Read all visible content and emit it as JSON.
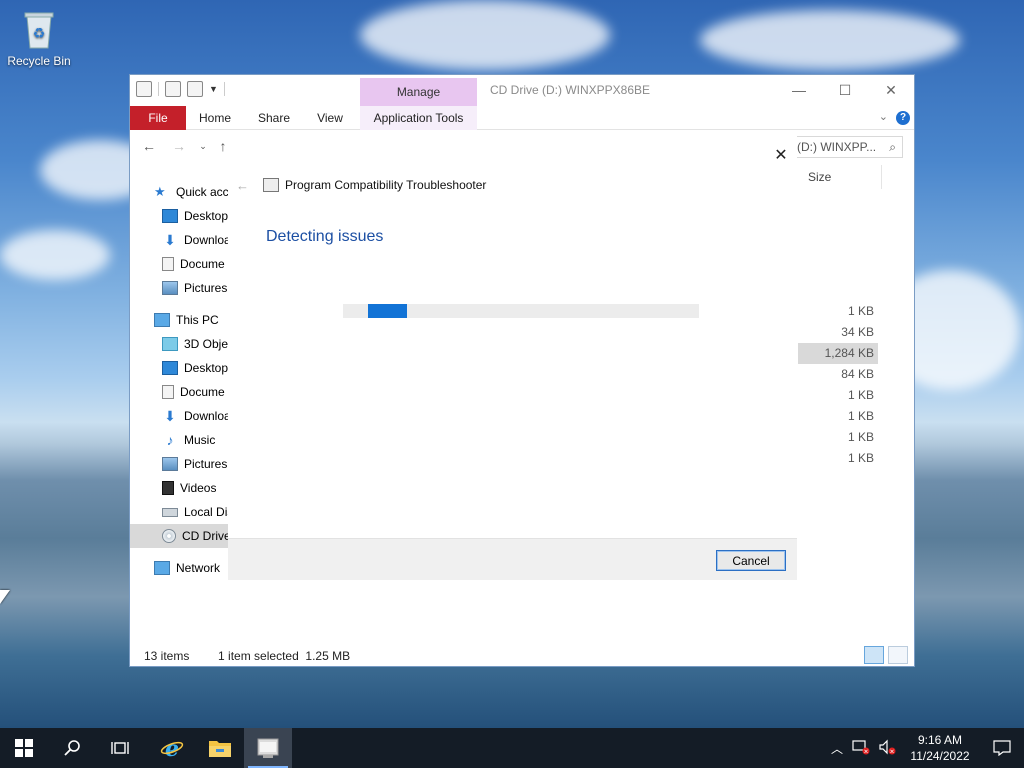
{
  "desktop": {
    "recycle_bin_label": "Recycle Bin"
  },
  "explorer": {
    "title": "CD Drive (D:) WINXPPX86BE",
    "manage_tab": "Manage",
    "ribbon_tabs": {
      "file": "File",
      "home": "Home",
      "share": "Share",
      "view": "View",
      "application_tools": "Application Tools"
    },
    "search_text": "(D:) WINXPP...",
    "column_size": "Size",
    "nav": {
      "quick_access": "Quick acc",
      "qa_desktop": "Desktop",
      "qa_downloads": "Downloa",
      "qa_documents": "Docume",
      "qa_pictures": "Pictures",
      "this_pc": "This PC",
      "objects3d": "3D Objec",
      "desktop": "Desktop",
      "documents": "Docume",
      "downloads": "Downloa",
      "music": "Music",
      "pictures": "Pictures",
      "videos": "Videos",
      "local_disk": "Local Dis",
      "cd_drive": "CD Drive",
      "network": "Network"
    },
    "sizes": [
      "1 KB",
      "34 KB",
      "1,284 KB",
      "84 KB",
      "1 KB",
      "1 KB",
      "1 KB",
      "1 KB"
    ],
    "selected_size_index": 2,
    "status": {
      "items": "13 items",
      "selection": "1 item selected  1.25 MB"
    }
  },
  "troubleshooter": {
    "header": "Program Compatibility Troubleshooter",
    "status_title": "Detecting issues",
    "progress_indeterminate": true,
    "cancel_label": "Cancel"
  },
  "taskbar": {
    "time": "9:16 AM",
    "date": "11/24/2022",
    "apps": [
      "start-icon",
      "search-icon",
      "task-view-icon",
      "internet-explorer-icon",
      "file-explorer-icon",
      "troubleshooter-icon"
    ]
  },
  "colors": {
    "accent": "#1273d6",
    "file_tab": "#c4202a",
    "manage_tab": "#e8c6f0",
    "dialog_title": "#1c4fa3"
  }
}
